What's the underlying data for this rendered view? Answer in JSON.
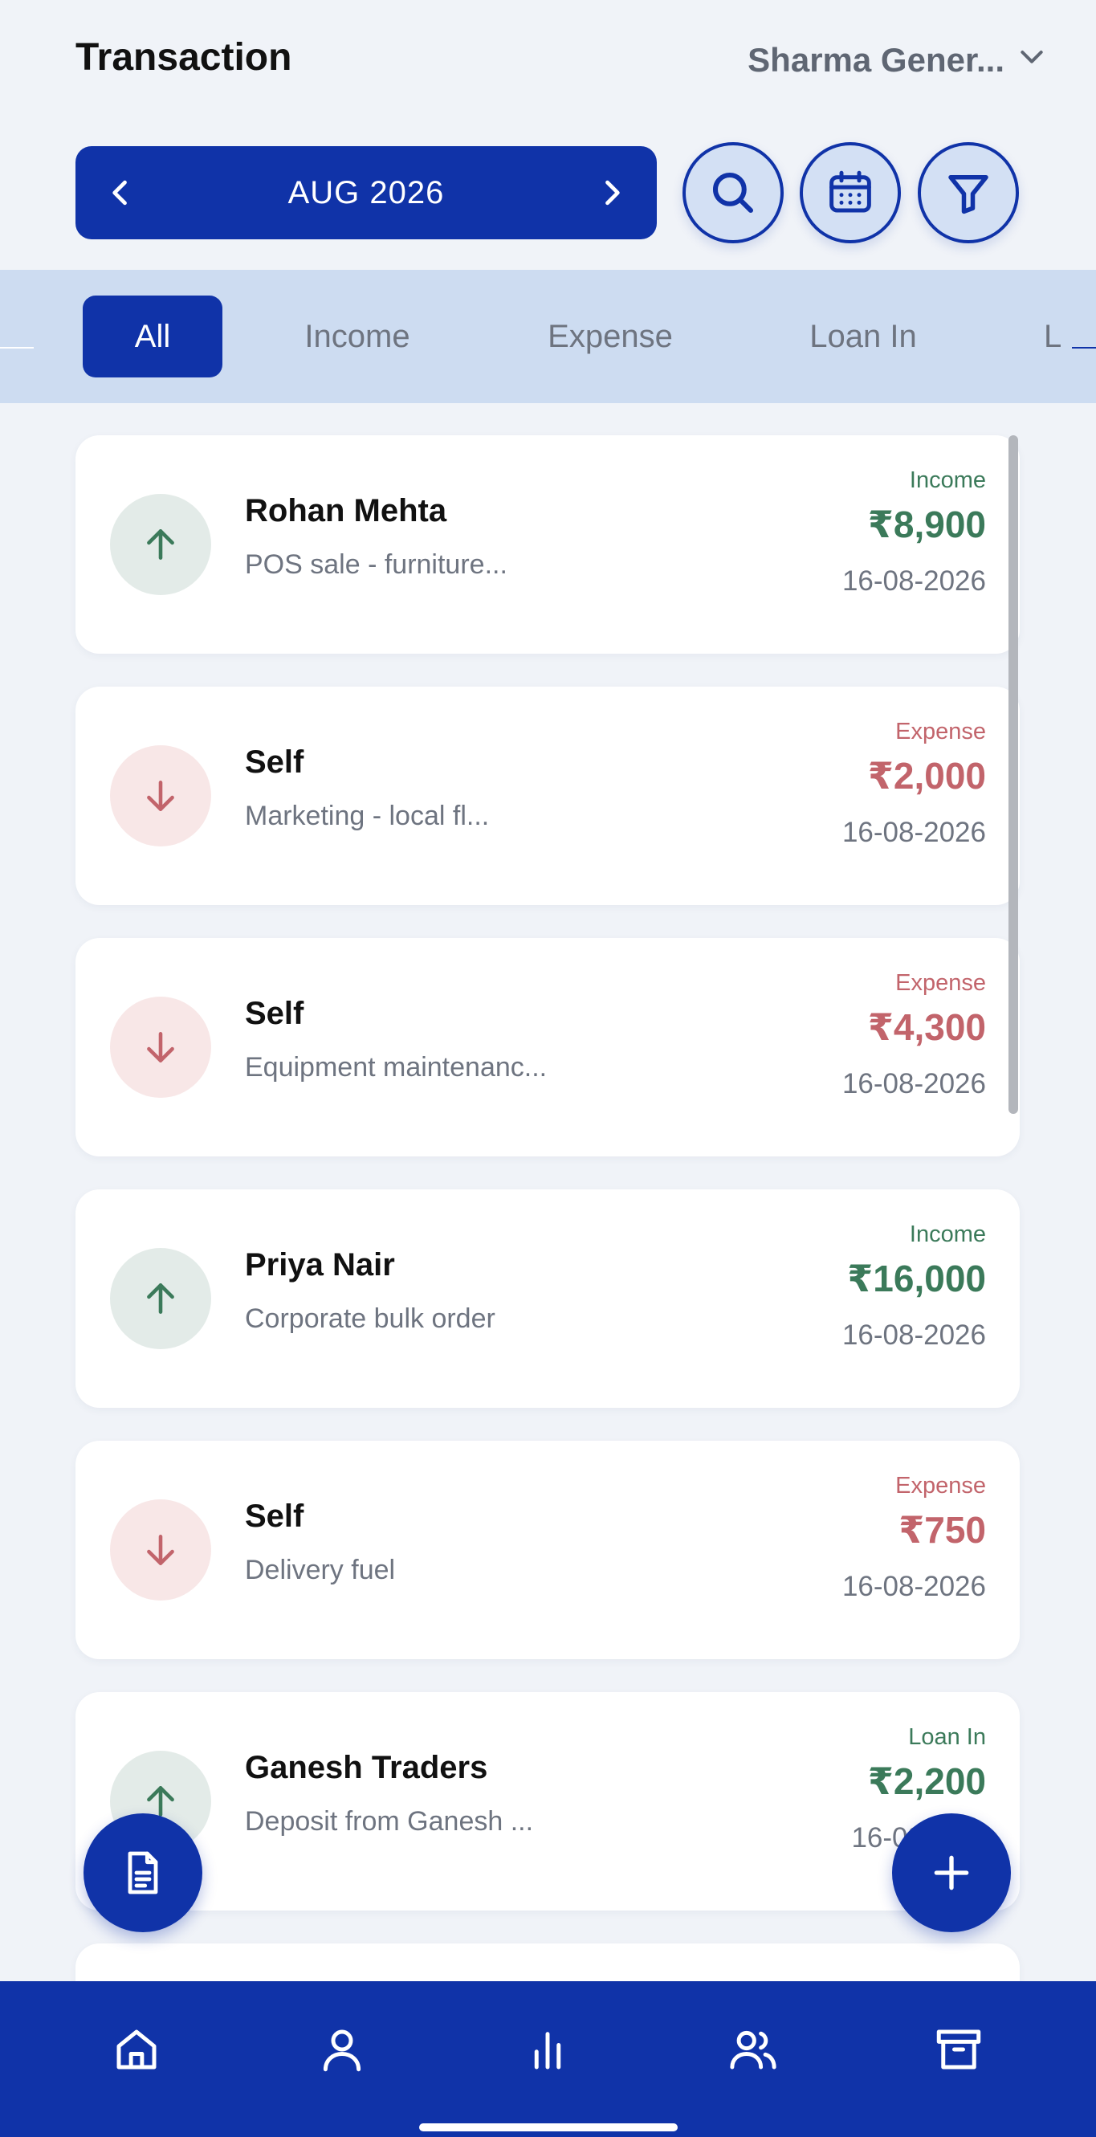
{
  "header": {
    "title": "Transaction",
    "business_name": "Sharma Gener..."
  },
  "month_selector": {
    "label": "AUG 2026"
  },
  "tabs": [
    {
      "label": "All",
      "active": true
    },
    {
      "label": "Income",
      "active": false
    },
    {
      "label": "Expense",
      "active": false
    },
    {
      "label": "Loan In",
      "active": false
    },
    {
      "label": "L",
      "active": false
    }
  ],
  "transactions": [
    {
      "name": "Rohan Mehta",
      "description": "POS sale - furniture...",
      "type": "Income",
      "amount": "₹8,900",
      "date": "16-08-2026",
      "direction": "up"
    },
    {
      "name": "Self",
      "description": "Marketing - local fl...",
      "type": "Expense",
      "amount": "₹2,000",
      "date": "16-08-2026",
      "direction": "down"
    },
    {
      "name": "Self",
      "description": "Equipment maintenanc...",
      "type": "Expense",
      "amount": "₹4,300",
      "date": "16-08-2026",
      "direction": "down"
    },
    {
      "name": "Priya Nair",
      "description": "Corporate bulk order",
      "type": "Income",
      "amount": "₹16,000",
      "date": "16-08-2026",
      "direction": "up"
    },
    {
      "name": "Self",
      "description": "Delivery fuel",
      "type": "Expense",
      "amount": "₹750",
      "date": "16-08-2026",
      "direction": "down"
    },
    {
      "name": "Ganesh Traders",
      "description": "Deposit from Ganesh ...",
      "type": "Loan In",
      "amount": "₹2,200",
      "date": "16-08",
      "direction": "up"
    }
  ],
  "icons": {
    "business_dropdown": "chevron-down-icon",
    "prev_month": "chevron-left-icon",
    "next_month": "chevron-right-icon",
    "search": "search-icon",
    "calendar": "calendar-icon",
    "filter": "filter-icon",
    "report_fab": "document-icon",
    "add_fab": "plus-icon",
    "nav": [
      "home-icon",
      "user-icon",
      "bar-chart-icon",
      "users-icon",
      "archive-icon"
    ]
  },
  "colors": {
    "primary": "#1033a8",
    "income": "#3b7a5a",
    "expense": "#c2646b",
    "tab_band": "#cddcf1",
    "background": "#f0f3f8"
  }
}
